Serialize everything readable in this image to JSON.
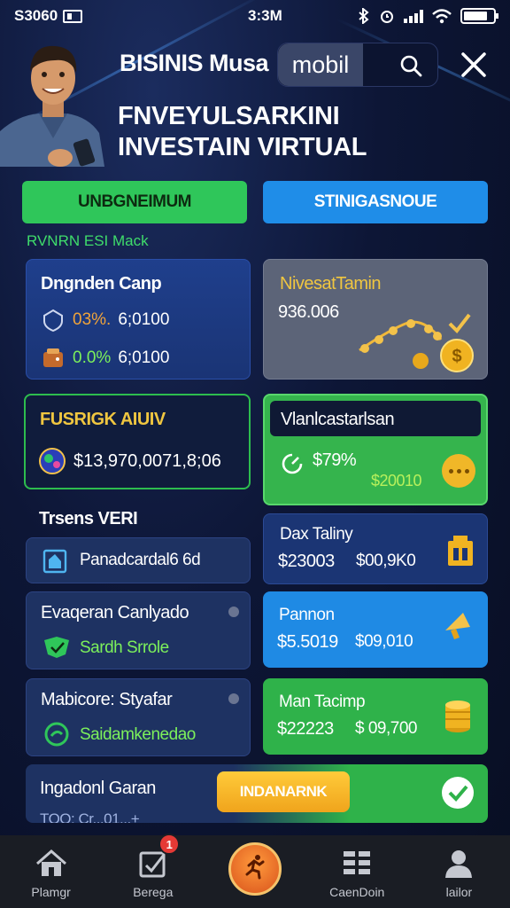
{
  "status_bar": {
    "left_text": "S3060",
    "time": "3:3M"
  },
  "header": {
    "brand": "BISINIS Musa",
    "search_value": "mobil",
    "headline_line1": "FNVEYULSARKINI",
    "headline_line2": "INVESTAIN VIRTUAL"
  },
  "tabs": {
    "primary": "UNBGNEIMUM",
    "secondary": "STINIGASNOUE"
  },
  "section_label": "RVNRN ESI Mack",
  "cards": {
    "budget": {
      "title": "Dngnden Canp",
      "row1_pct": "03%.",
      "row1_val": "6;0100",
      "row2_pct": "0.0%",
      "row2_val": "6;0100"
    },
    "invest": {
      "title": "NivesatTamin",
      "value": "936.006"
    },
    "fusion": {
      "title": "FUSRIGK AIUIV",
      "value": "$13,970,0071,8;06"
    },
    "vlan": {
      "title": "Vlanlcastarlsan",
      "pct": "$79%",
      "amount": "$20010"
    },
    "trends": {
      "title": "Trsens VERI",
      "item": "Panadcardal6 6d"
    },
    "dax": {
      "title": "Dax Taliny",
      "v1": "$23003",
      "v2": "$00,9K0"
    },
    "evaq": {
      "title": "Evaqeran Canlyado",
      "sub": "Sardh Srrole"
    },
    "pannon": {
      "title": "Pannon",
      "v1": "$5.5019",
      "v2": "$09,010"
    },
    "mabi": {
      "title": "Mabicore: Styafar",
      "sub": "Saidamkenedao"
    },
    "mant": {
      "title": "Man Tacimp",
      "v1": "$22223",
      "v2": "$ 09,700"
    },
    "banner": {
      "title": "Ingadonl Garan",
      "cta": "INDANARNK",
      "partial": "TOO: Cr...01...+"
    }
  },
  "nav": {
    "items": [
      "Plamgr",
      "Berega",
      "",
      "CaenDoin",
      "lailor"
    ],
    "badge": "1"
  },
  "colors": {
    "green": "#2fc65a",
    "blue": "#1f8de8",
    "orange": "#f1a43a",
    "gold": "#f0c640",
    "nav_bg": "#1a1d24"
  }
}
